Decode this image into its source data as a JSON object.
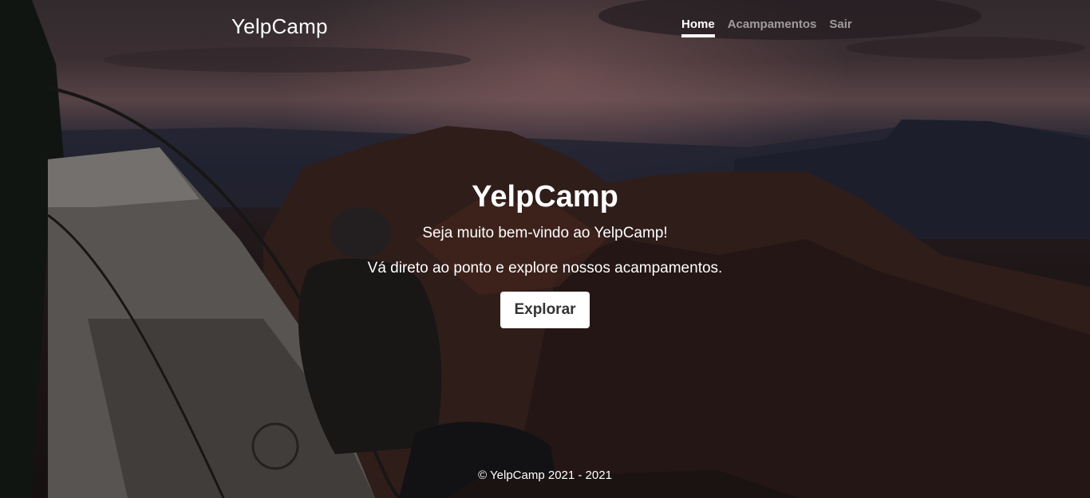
{
  "navbar": {
    "brand": "YelpCamp",
    "links": [
      {
        "label": "Home",
        "active": true
      },
      {
        "label": "Acampamentos",
        "active": false
      },
      {
        "label": "Sair",
        "active": false
      }
    ]
  },
  "hero": {
    "title": "YelpCamp",
    "welcome": "Seja muito bem-vindo ao YelpCamp!",
    "tagline": "Vá direto ao ponto e explore nossos acampamentos.",
    "button_label": "Explorar"
  },
  "footer": {
    "copyright": "© YelpCamp 2021 - 2021"
  },
  "colors": {
    "button_bg": "#ffffff",
    "button_text": "#333333",
    "nav_inactive": "rgba(255,255,255,0.55)"
  }
}
